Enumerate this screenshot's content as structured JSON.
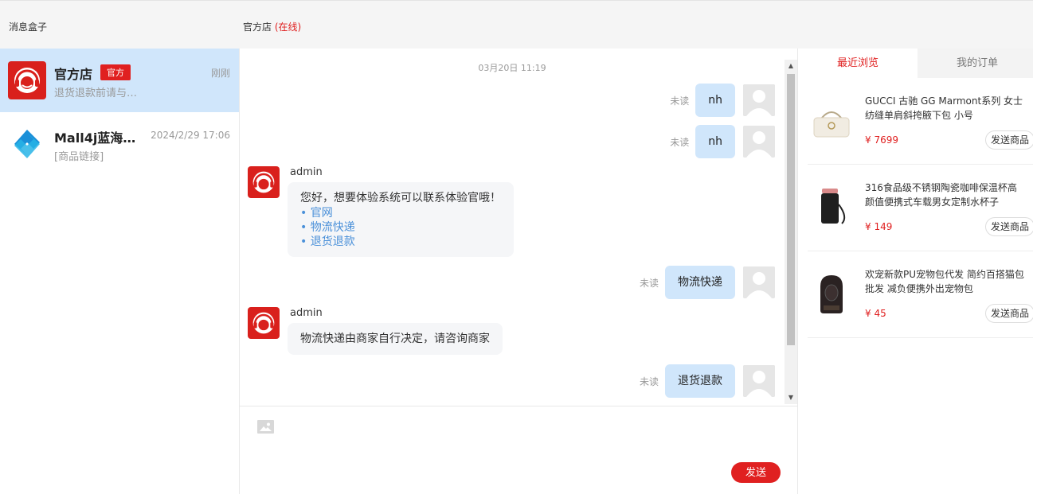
{
  "header": {
    "box_title": "消息盒子",
    "shop_name": "官方店",
    "shop_status": "(在线)"
  },
  "conversations": [
    {
      "name": "官方店",
      "badge": "官方",
      "time": "刚刚",
      "preview": "退货退款前请与…",
      "active": true
    },
    {
      "name": "Mall4j蓝海…",
      "time": "2024/2/29 17:06",
      "preview": "[商品链接]",
      "active": false
    }
  ],
  "chat": {
    "date": "03月20日 11:19",
    "messages": [
      {
        "side": "right",
        "status": "未读",
        "text": "nh"
      },
      {
        "side": "right",
        "status": "未读",
        "text": "nh"
      },
      {
        "side": "left",
        "sender": "admin",
        "text": "您好，想要体验系统可以联系体验官哦！",
        "links": [
          "• 官网",
          "• 物流快递",
          "• 退货退款"
        ]
      },
      {
        "side": "right",
        "status": "未读",
        "text": "物流快递"
      },
      {
        "side": "left",
        "sender": "admin",
        "text": "物流快递由商家自行决定，请咨询商家"
      },
      {
        "side": "right",
        "status": "未读",
        "text": "退货退款"
      }
    ]
  },
  "input": {
    "send_label": "发送"
  },
  "right_panel": {
    "tabs": [
      "最近浏览",
      "我的订单"
    ],
    "active_tab": 0,
    "products": [
      {
        "title": "GUCCI 古驰 GG Marmont系列 女士纺缝单肩斜挎腋下包 小号",
        "price": "¥ 7699",
        "button": "发送商品"
      },
      {
        "title": "316食品级不锈钢陶瓷咖啡保温杯高颜值便携式车载男女定制水杯子",
        "price": "¥ 149",
        "button": "发送商品"
      },
      {
        "title": "欢宠新款PU宠物包代发 简约百搭猫包批发 减负便携外出宠物包",
        "price": "¥ 45",
        "button": "发送商品"
      }
    ]
  },
  "colors": {
    "accent": "#e02020",
    "bubble_self": "#d0e6fb",
    "link": "#4a90d9"
  }
}
